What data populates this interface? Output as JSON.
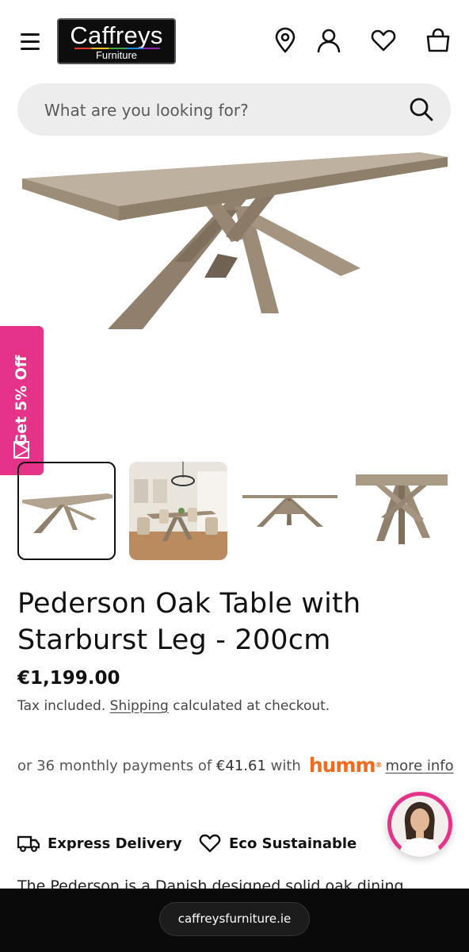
{
  "header": {
    "logo_main": "Caffreys",
    "logo_sub": "Furniture",
    "icons": [
      "menu-icon",
      "location-pin-icon",
      "account-icon",
      "wishlist-heart-icon",
      "cart-bag-icon"
    ]
  },
  "search": {
    "placeholder": "What are you looking for?",
    "value": ""
  },
  "promo_tab": {
    "label": "Get 5% Off",
    "color": "#e6338a"
  },
  "gallery": {
    "thumbnail_count": 4,
    "selected_index": 0
  },
  "product": {
    "title": "Pederson Oak Table with Starburst Leg - 200cm",
    "price": "€1,199.00",
    "tax_prefix": "Tax included. ",
    "shipping_link": "Shipping",
    "tax_suffix": " calculated at checkout.",
    "finance_prefix": "or 36 monthly payments of ",
    "finance_amount": "€41.61",
    "finance_with": " with",
    "finance_brand": "humm",
    "finance_link": "more info",
    "features": [
      "Express Delivery",
      "Eco Sustainable"
    ],
    "description_start": "The Pederson is a Danish designed solid oak dining"
  },
  "browser": {
    "url": "caffreysfurniture.ie"
  },
  "colors": {
    "accent_pink": "#e6338a",
    "humm_orange": "#f26a1b",
    "wood": "#a0907c"
  }
}
